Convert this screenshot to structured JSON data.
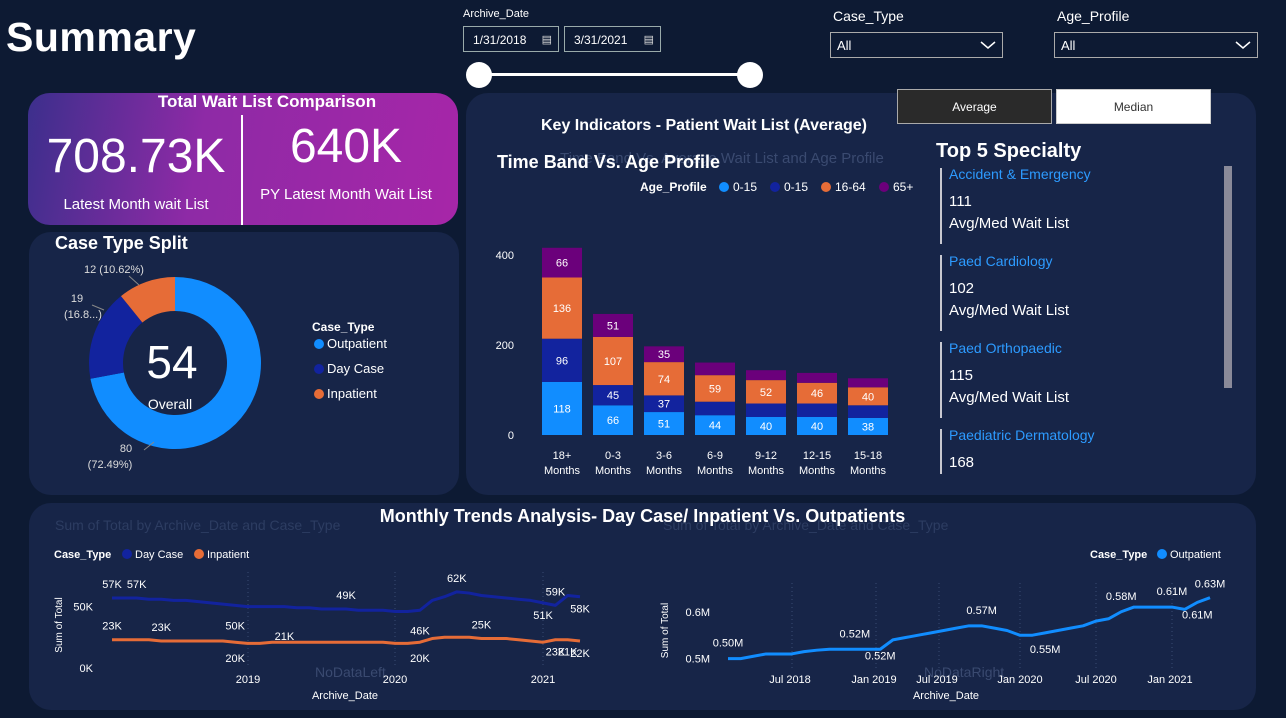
{
  "header": {
    "title": "Summary"
  },
  "filters": {
    "archive_date_label": "Archive_Date",
    "start_date": "1/31/2018",
    "end_date": "3/31/2021",
    "calendar_icon": "calendar-icon",
    "case_type_label": "Case_Type",
    "case_type_value": "All",
    "age_profile_label": "Age_Profile",
    "age_profile_value": "All",
    "chevron": "⌵"
  },
  "toggle": {
    "average": "Average",
    "median": "Median",
    "selected": "Average"
  },
  "kpi": {
    "title": "Total Wait List Comparison",
    "latest_value": "708.73K",
    "latest_label": "Latest Month wait List",
    "py_value": "640K",
    "py_label": "PY Latest Month Wait List"
  },
  "case_type_split": {
    "title": "Case Type Split",
    "center_value": "54",
    "center_label": "Overall",
    "legend_title": "Case_Type",
    "label_inpatient": "12 (10.62%)",
    "label_daycase_1": "19",
    "label_daycase_2": "(16.8...)",
    "label_outpatient_1": "80",
    "label_outpatient_2": "(72.49%)"
  },
  "key_indicators": {
    "title": "Key Indicators - Patient Wait List (Average)"
  },
  "time_band": {
    "title": "Time Band Vs. Age Profile",
    "ghost_title": "Time Band Vs. Average Wait List and Age Profile",
    "legend_title": "Age_Profile"
  },
  "top5": {
    "title": "Top 5 Specialty",
    "items": [
      {
        "name": "Accident & Emergency",
        "value": "111",
        "sub": "Avg/Med Wait List"
      },
      {
        "name": "Paed Cardiology",
        "value": "102",
        "sub": "Avg/Med Wait List"
      },
      {
        "name": "Paed Orthopaedic",
        "value": "115",
        "sub": "Avg/Med Wait List"
      },
      {
        "name": "Paediatric Dermatology",
        "value": "168",
        "sub": ""
      }
    ]
  },
  "monthly": {
    "title": "Monthly Trends Analysis- Day Case/ Inpatient Vs. Outpatients",
    "ghost_left": "Sum of Total by Archive_Date and Case_Type",
    "ghost_right": "Sum of Total by Archive_Date and Case_Type",
    "no_data_left": "NoDataLeft",
    "no_data_right": "NoDataRight",
    "left_legend_title": "Case_Type",
    "right_legend_title": "Case_Type"
  },
  "chart_data": [
    {
      "type": "pie",
      "title": "Case Type Split",
      "categories": [
        "Outpatient",
        "Day Case",
        "Inpatient"
      ],
      "values": [
        80,
        19,
        12
      ],
      "percent_labels": [
        "72.49%",
        "16.8...",
        "10.62%"
      ],
      "colors": [
        "#118dff",
        "#12239e",
        "#e66c37"
      ],
      "legend": "right"
    },
    {
      "type": "bar",
      "title": "Time Band Vs. Age Profile",
      "categories": [
        "18+ Months",
        "0-3 Months",
        "3-6 Months",
        "6-9 Months",
        "9-12 Months",
        "12-15 Months",
        "15-18 Months"
      ],
      "series": [
        {
          "name": "0-15",
          "color": "#118dff",
          "values": [
            118,
            66,
            51,
            44,
            40,
            40,
            38
          ]
        },
        {
          "name": "0-15",
          "color": "#12239e",
          "values": [
            96,
            45,
            37,
            30,
            30,
            30,
            28
          ]
        },
        {
          "name": "16-64",
          "color": "#e66c37",
          "values": [
            136,
            107,
            74,
            59,
            52,
            46,
            40
          ]
        },
        {
          "name": "65+",
          "color": "#6b007b",
          "values": [
            66,
            51,
            35,
            28,
            22,
            22,
            20
          ]
        }
      ],
      "show_labels": [
        [
          true,
          true,
          true,
          true,
          true,
          true,
          true
        ],
        [
          true,
          true,
          true,
          false,
          false,
          false,
          false
        ],
        [
          true,
          true,
          true,
          true,
          true,
          true,
          true
        ],
        [
          true,
          true,
          true,
          false,
          false,
          false,
          false
        ]
      ],
      "ylim": [
        0,
        420
      ],
      "yticks": [
        0,
        200,
        400
      ],
      "stacked": true,
      "legend": "top"
    },
    {
      "type": "line",
      "x": [
        "2018-01",
        "2018-02",
        "2018-03",
        "2018-04",
        "2018-05",
        "2018-06",
        "2018-07",
        "2018-08",
        "2018-09",
        "2018-10",
        "2018-11",
        "2018-12",
        "2019-01",
        "2019-02",
        "2019-03",
        "2019-04",
        "2019-05",
        "2019-06",
        "2019-07",
        "2019-08",
        "2019-09",
        "2019-10",
        "2019-11",
        "2019-12",
        "2020-01",
        "2020-02",
        "2020-03",
        "2020-04",
        "2020-05",
        "2020-06",
        "2020-07",
        "2020-08",
        "2020-09",
        "2020-10",
        "2020-11",
        "2020-12",
        "2021-01",
        "2021-02",
        "2021-03"
      ],
      "series": [
        {
          "name": "Day Case",
          "color": "#12239e",
          "values": [
            57,
            57,
            57,
            56,
            56,
            55,
            55,
            54,
            53,
            52,
            51,
            50,
            50,
            50,
            50,
            49,
            49,
            48,
            48,
            48,
            47,
            47,
            47,
            46,
            46,
            47,
            55,
            58,
            62,
            61,
            59,
            58,
            57,
            56,
            55,
            53,
            51,
            59,
            58
          ]
        },
        {
          "name": "Inpatient",
          "color": "#e66c37",
          "values": [
            23,
            23,
            23,
            23,
            22,
            22,
            22,
            22,
            22,
            22,
            21,
            20,
            20,
            21,
            21,
            21,
            21,
            21,
            21,
            21,
            21,
            21,
            21,
            20,
            20,
            21,
            24,
            25,
            25,
            25,
            24,
            24,
            24,
            23,
            22,
            21,
            23,
            23,
            22
          ]
        }
      ],
      "point_labels": {
        "Day Case": [
          "57K",
          "57K",
          "49K",
          "46K",
          "62K",
          "51K",
          "59K",
          "58K",
          "50K"
        ],
        "Inpatient": [
          "23K",
          "23K",
          "21K",
          "20K",
          "25K",
          "21K",
          "23K",
          "22K",
          "20K"
        ]
      },
      "ylim": [
        0,
        70
      ],
      "yticks": [
        "0K",
        "50K"
      ],
      "xticks": [
        "2019",
        "2020",
        "2021"
      ],
      "xlabel": "Archive_Date",
      "ylabel": "Sum of Total",
      "legend": "top-left"
    },
    {
      "type": "line",
      "x": [
        "2018-01",
        "2018-02",
        "2018-03",
        "2018-04",
        "2018-05",
        "2018-06",
        "2018-07",
        "2018-08",
        "2018-09",
        "2018-10",
        "2018-11",
        "2018-12",
        "2019-01",
        "2019-02",
        "2019-03",
        "2019-04",
        "2019-05",
        "2019-06",
        "2019-07",
        "2019-08",
        "2019-09",
        "2019-10",
        "2019-11",
        "2019-12",
        "2020-01",
        "2020-02",
        "2020-03",
        "2020-04",
        "2020-05",
        "2020-06",
        "2020-07",
        "2020-08",
        "2020-09",
        "2020-10",
        "2020-11",
        "2020-12",
        "2021-01",
        "2021-02",
        "2021-03"
      ],
      "series": [
        {
          "name": "Outpatient",
          "color": "#118dff",
          "values": [
            0.5,
            0.5,
            0.505,
            0.51,
            0.51,
            0.51,
            0.515,
            0.518,
            0.52,
            0.52,
            0.52,
            0.52,
            0.52,
            0.54,
            0.545,
            0.55,
            0.555,
            0.56,
            0.565,
            0.57,
            0.57,
            0.565,
            0.56,
            0.55,
            0.55,
            0.555,
            0.56,
            0.565,
            0.57,
            0.58,
            0.585,
            0.6,
            0.61,
            0.61,
            0.61,
            0.61,
            0.605,
            0.62,
            0.63
          ]
        }
      ],
      "point_labels": {
        "Outpatient": [
          "0.50M",
          "0.52M",
          "0.52M",
          "0.57M",
          "0.55M",
          "0.58M",
          "0.61M",
          "0.61M",
          "0.63M"
        ]
      },
      "ylim": [
        0.48,
        0.64
      ],
      "yticks": [
        "0.5M",
        "0.6M"
      ],
      "xticks": [
        "Jul 2018",
        "Jan 2019",
        "Jul 2019",
        "Jan 2020",
        "Jul 2020",
        "Jan 2021"
      ],
      "xlabel": "Archive_Date",
      "ylabel": "Sum of Total",
      "legend": "top-right"
    }
  ]
}
